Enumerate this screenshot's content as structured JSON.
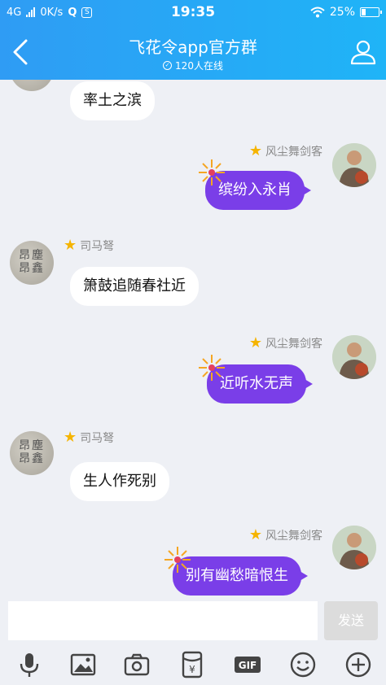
{
  "status_bar": {
    "network": "4G",
    "speed": "0K/s",
    "time": "19:35",
    "battery_text": "25%",
    "battery_level": 0.25
  },
  "header": {
    "title": "飞花令app官方群",
    "online_count": "120人在线"
  },
  "messages": [
    {
      "side": "left",
      "sender": "",
      "text": "率土之滨"
    },
    {
      "side": "right",
      "sender": "风尘舞剑客",
      "text": "缤纷入永肖"
    },
    {
      "side": "left",
      "sender": "司马弩",
      "text": "箫鼓追随春社近"
    },
    {
      "side": "right",
      "sender": "风尘舞剑客",
      "text": "近听水无声"
    },
    {
      "side": "left",
      "sender": "司马弩",
      "text": "生人作死别"
    },
    {
      "side": "right",
      "sender": "风尘舞剑客",
      "text": "别有幽愁暗恨生"
    }
  ],
  "avatar_glyphs": "昂塵\n昂鑫",
  "input": {
    "placeholder": "",
    "send_label": "发送"
  },
  "toolbar": {
    "items": [
      "microphone-icon",
      "image-icon",
      "camera-icon",
      "red-packet-icon",
      "gif-icon",
      "emoji-icon",
      "plus-icon"
    ],
    "gif_label": "GIF",
    "yen_label": "¥"
  },
  "colors": {
    "header": "#2f9cf4",
    "purple_bubble": "#7a3ee8",
    "star": "#f5b400"
  }
}
